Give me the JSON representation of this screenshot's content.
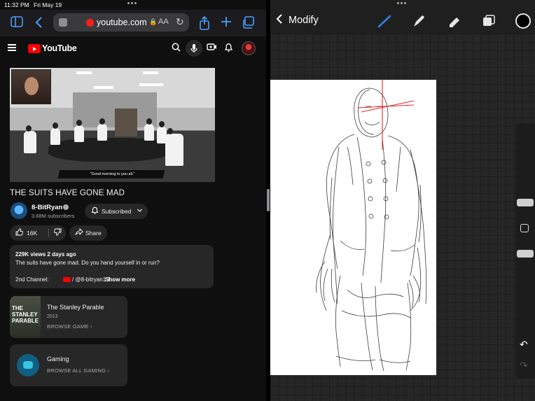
{
  "status_bar": {
    "time": "11:32 PM",
    "date": "Fri May 19"
  },
  "safari": {
    "url": "youtube.com",
    "lock_glyph": "🔒",
    "reader_label": "AA",
    "icons": [
      "sidebar-icon",
      "back-icon",
      "share-icon",
      "new-tab-icon",
      "tabs-icon"
    ]
  },
  "youtube": {
    "brand": "YouTube",
    "video": {
      "title": "THE SUITS HAVE GONE MAD",
      "subtitle_caption": "\"Good morning to you all.\""
    },
    "channel": {
      "name": "8-BitRyan",
      "subscribers": "3.68M subscribers"
    },
    "subscribe_label": "Subscribed",
    "like_count": "16K",
    "share_label": "Share",
    "description": {
      "meta": "229K views  2 days ago",
      "text": "The suits have gone mad. Do you hand yourself in or run?",
      "second_channel_label": "2nd Channel:",
      "second_channel_handle": "/ @8-bitryan1.1",
      "show_more": "Show more"
    },
    "cards": [
      {
        "title": "The Stanley Parable",
        "year": "2013",
        "action": "BROWSE GAME  ›",
        "thumb_text": "THE STANLEY PARABLE"
      },
      {
        "title": "Gaming",
        "action": "BROWSE ALL GAMING  ›"
      }
    ]
  },
  "procreate": {
    "back_label": "Modify",
    "tools": [
      "brush-icon",
      "smudge-icon",
      "eraser-icon",
      "layers-icon",
      "color-swatch"
    ],
    "active_tool": "brush",
    "current_color": "#000000",
    "accent_color": "#2f7fe5"
  },
  "colors": {
    "youtube_red": "#ff0000",
    "safari_blue": "#4a9dff",
    "youtube_bg": "#0f0f0f",
    "procreate_bg": "#262626"
  }
}
